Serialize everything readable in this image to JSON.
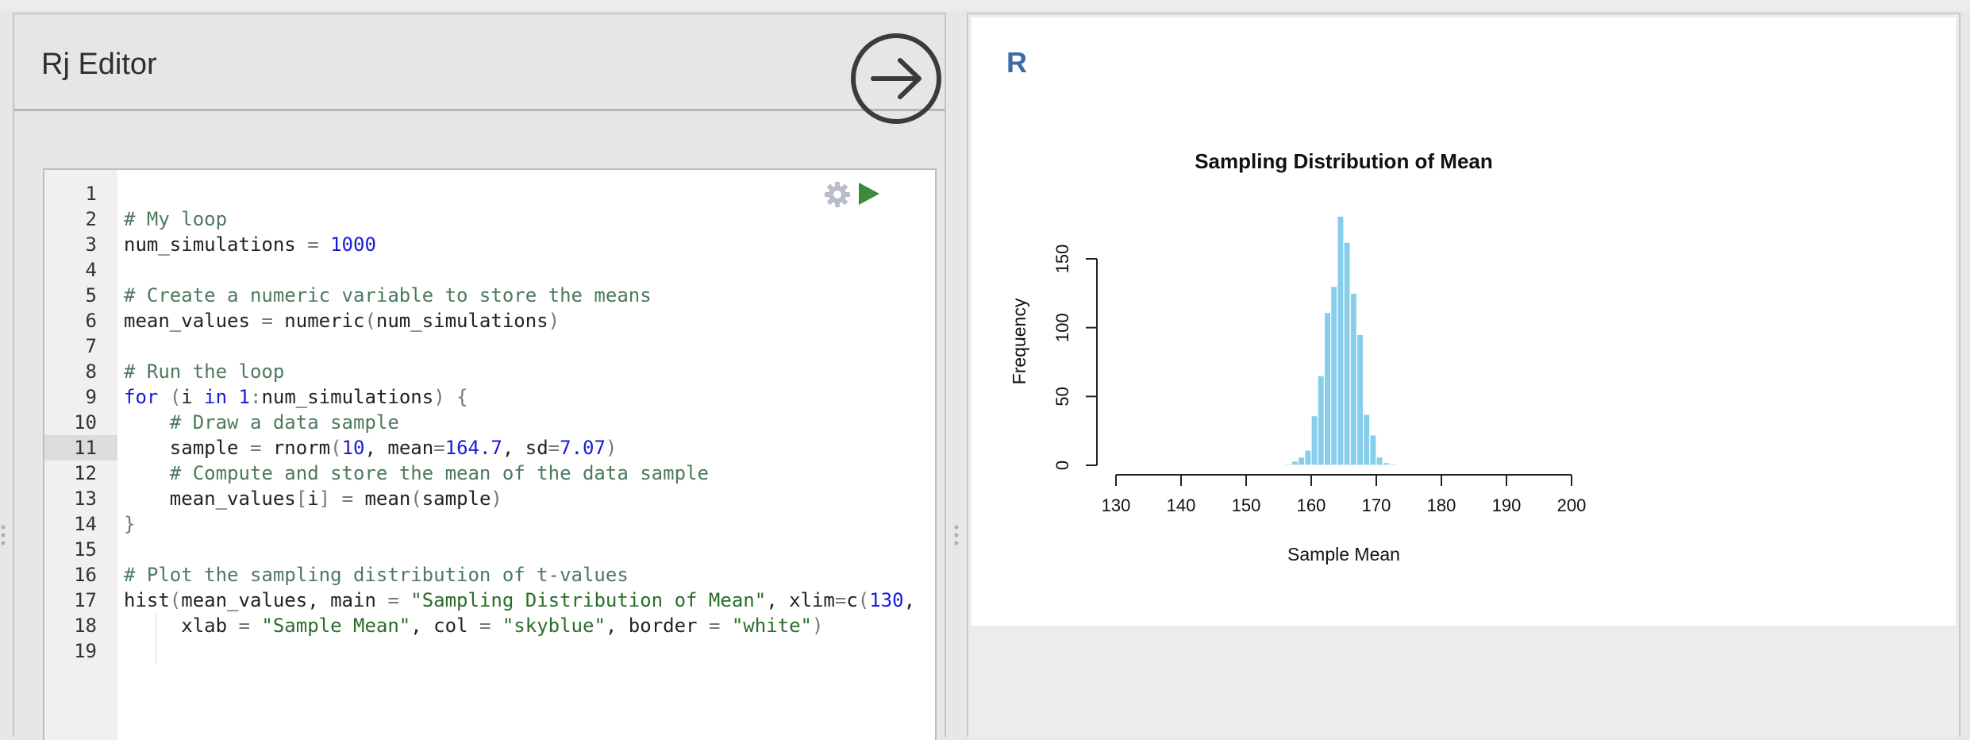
{
  "left_panel": {
    "title": "Rj Editor",
    "run_icon": "arrow-right-circle-icon"
  },
  "editor": {
    "settings_icon": "gear-icon",
    "run_icon": "play-icon",
    "active_line": 11,
    "lines": [
      {
        "n": "1",
        "tokens": []
      },
      {
        "n": "2",
        "tokens": [
          {
            "t": "# My loop",
            "c": "comment"
          }
        ]
      },
      {
        "n": "3",
        "tokens": [
          {
            "t": "num_simulations ",
            "c": ""
          },
          {
            "t": "=",
            "c": "op"
          },
          {
            "t": " ",
            "c": ""
          },
          {
            "t": "1000",
            "c": "num"
          }
        ]
      },
      {
        "n": "4",
        "tokens": []
      },
      {
        "n": "5",
        "tokens": [
          {
            "t": "# Create a numeric variable to store the means",
            "c": "comment"
          }
        ]
      },
      {
        "n": "6",
        "tokens": [
          {
            "t": "mean_values ",
            "c": ""
          },
          {
            "t": "=",
            "c": "op"
          },
          {
            "t": " numeric",
            "c": ""
          },
          {
            "t": "(",
            "c": "op"
          },
          {
            "t": "num_simulations",
            "c": ""
          },
          {
            "t": ")",
            "c": "op"
          }
        ]
      },
      {
        "n": "7",
        "tokens": []
      },
      {
        "n": "8",
        "tokens": [
          {
            "t": "# Run the loop",
            "c": "comment"
          }
        ]
      },
      {
        "n": "9",
        "tokens": [
          {
            "t": "for",
            "c": "kw"
          },
          {
            "t": " ",
            "c": ""
          },
          {
            "t": "(",
            "c": "op"
          },
          {
            "t": "i ",
            "c": ""
          },
          {
            "t": "in",
            "c": "kw"
          },
          {
            "t": " ",
            "c": ""
          },
          {
            "t": "1",
            "c": "num"
          },
          {
            "t": ":",
            "c": "op"
          },
          {
            "t": "num_simulations",
            "c": ""
          },
          {
            "t": ")",
            "c": "op"
          },
          {
            "t": " ",
            "c": ""
          },
          {
            "t": "{",
            "c": "op"
          }
        ]
      },
      {
        "n": "10",
        "tokens": [
          {
            "t": "    ",
            "c": ""
          },
          {
            "t": "# Draw a data sample",
            "c": "comment"
          }
        ]
      },
      {
        "n": "11",
        "tokens": [
          {
            "t": "    sample ",
            "c": ""
          },
          {
            "t": "=",
            "c": "op"
          },
          {
            "t": " rnorm",
            "c": ""
          },
          {
            "t": "(",
            "c": "op"
          },
          {
            "t": "10",
            "c": "num"
          },
          {
            "t": ", mean",
            "c": ""
          },
          {
            "t": "=",
            "c": "op"
          },
          {
            "t": "164.7",
            "c": "num"
          },
          {
            "t": ", sd",
            "c": ""
          },
          {
            "t": "=",
            "c": "op"
          },
          {
            "t": "7.07",
            "c": "num"
          },
          {
            "t": ")",
            "c": "op"
          }
        ]
      },
      {
        "n": "12",
        "tokens": [
          {
            "t": "    ",
            "c": ""
          },
          {
            "t": "# Compute and store the mean of the data sample",
            "c": "comment"
          }
        ]
      },
      {
        "n": "13",
        "tokens": [
          {
            "t": "    mean_values",
            "c": ""
          },
          {
            "t": "[",
            "c": "op"
          },
          {
            "t": "i",
            "c": ""
          },
          {
            "t": "]",
            "c": "op"
          },
          {
            "t": " ",
            "c": ""
          },
          {
            "t": "=",
            "c": "op"
          },
          {
            "t": " mean",
            "c": ""
          },
          {
            "t": "(",
            "c": "op"
          },
          {
            "t": "sample",
            "c": ""
          },
          {
            "t": ")",
            "c": "op"
          }
        ]
      },
      {
        "n": "14",
        "tokens": [
          {
            "t": "}",
            "c": "op"
          }
        ]
      },
      {
        "n": "15",
        "tokens": []
      },
      {
        "n": "16",
        "tokens": [
          {
            "t": "# Plot the sampling distribution of t-values",
            "c": "comment"
          }
        ]
      },
      {
        "n": "17",
        "tokens": [
          {
            "t": "hist",
            "c": ""
          },
          {
            "t": "(",
            "c": "op"
          },
          {
            "t": "mean_values, main ",
            "c": ""
          },
          {
            "t": "=",
            "c": "op"
          },
          {
            "t": " ",
            "c": ""
          },
          {
            "t": "\"Sampling Distribution of Mean\"",
            "c": "str"
          },
          {
            "t": ", xlim",
            "c": ""
          },
          {
            "t": "=",
            "c": "op"
          },
          {
            "t": "c",
            "c": ""
          },
          {
            "t": "(",
            "c": "op"
          },
          {
            "t": "130",
            "c": "num"
          },
          {
            "t": ",",
            "c": ""
          }
        ]
      },
      {
        "n": "18",
        "tokens": [
          {
            "t": "     xlab ",
            "c": ""
          },
          {
            "t": "=",
            "c": "op"
          },
          {
            "t": " ",
            "c": ""
          },
          {
            "t": "\"Sample Mean\"",
            "c": "str"
          },
          {
            "t": ", col ",
            "c": ""
          },
          {
            "t": "=",
            "c": "op"
          },
          {
            "t": " ",
            "c": ""
          },
          {
            "t": "\"skyblue\"",
            "c": "str"
          },
          {
            "t": ", border ",
            "c": ""
          },
          {
            "t": "=",
            "c": "op"
          },
          {
            "t": " ",
            "c": ""
          },
          {
            "t": "\"white\"",
            "c": "str"
          },
          {
            "t": ")",
            "c": "op"
          }
        ]
      },
      {
        "n": "19",
        "tokens": []
      }
    ],
    "colors": {
      "comment": "#4c7a5e",
      "num": "#1a1adb",
      "kw": "#1a1adb",
      "str": "#2a6d2a",
      "op": "#777777"
    }
  },
  "output": {
    "label": "R"
  },
  "chart_data": {
    "type": "bar",
    "title": "Sampling Distribution of Mean",
    "xlabel": "Sample Mean",
    "ylabel": "Frequency",
    "xlim": [
      130,
      200
    ],
    "ylim": [
      0,
      185
    ],
    "x_ticks": [
      130,
      140,
      150,
      160,
      170,
      180,
      190,
      200
    ],
    "y_ticks": [
      0,
      50,
      100,
      150
    ],
    "bar_color": "#87ceeb",
    "border_color": "#ffffff",
    "bin_width": 1,
    "bins": [
      {
        "start": 156,
        "end": 157,
        "count": 1
      },
      {
        "start": 157,
        "end": 158,
        "count": 3
      },
      {
        "start": 158,
        "end": 159,
        "count": 6
      },
      {
        "start": 159,
        "end": 160,
        "count": 11
      },
      {
        "start": 160,
        "end": 161,
        "count": 36
      },
      {
        "start": 161,
        "end": 162,
        "count": 65
      },
      {
        "start": 162,
        "end": 163,
        "count": 111
      },
      {
        "start": 163,
        "end": 164,
        "count": 130
      },
      {
        "start": 164,
        "end": 165,
        "count": 181
      },
      {
        "start": 165,
        "end": 166,
        "count": 162
      },
      {
        "start": 166,
        "end": 167,
        "count": 125
      },
      {
        "start": 167,
        "end": 168,
        "count": 95
      },
      {
        "start": 168,
        "end": 169,
        "count": 37
      },
      {
        "start": 169,
        "end": 170,
        "count": 22
      },
      {
        "start": 170,
        "end": 171,
        "count": 6
      },
      {
        "start": 171,
        "end": 172,
        "count": 2
      },
      {
        "start": 172,
        "end": 173,
        "count": 1
      }
    ]
  }
}
